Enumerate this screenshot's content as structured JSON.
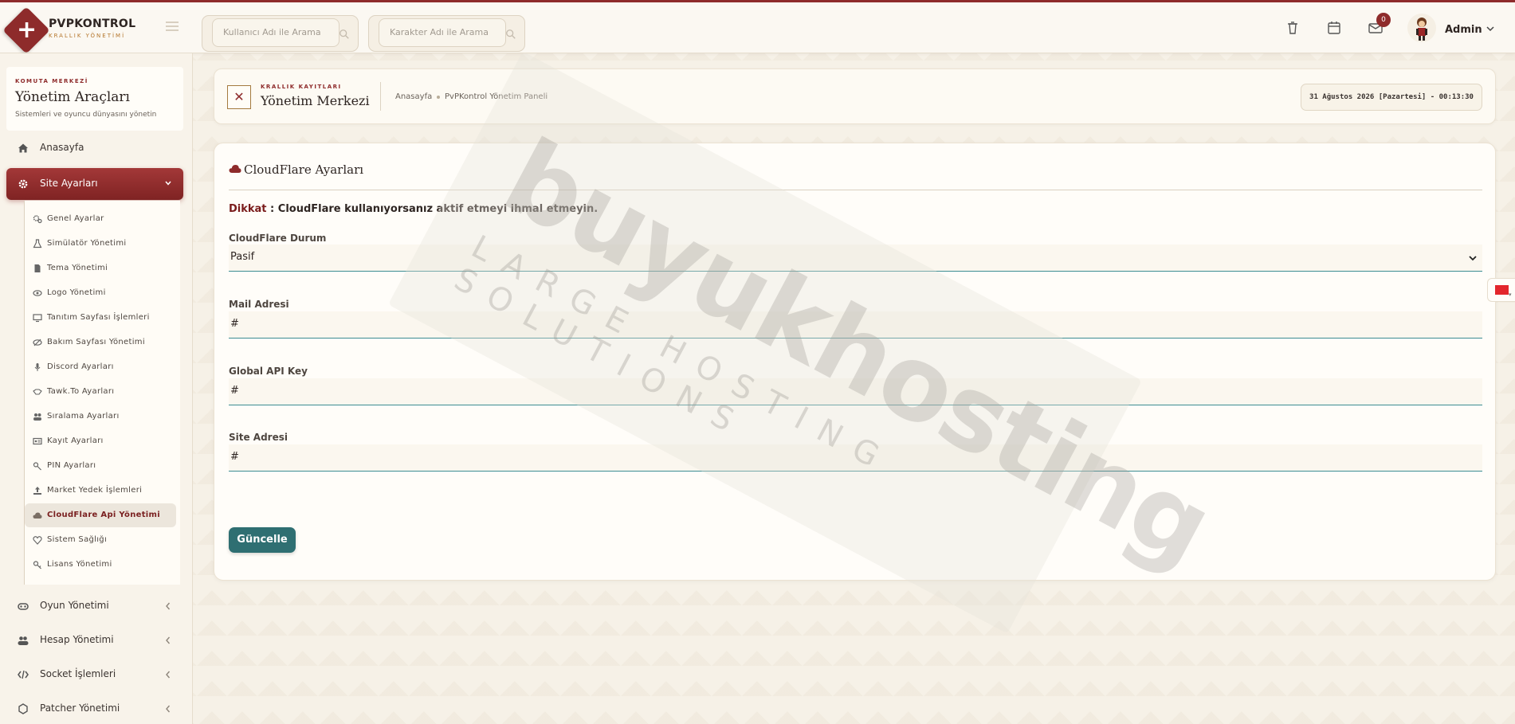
{
  "brand": {
    "title": "PVPKONTROL",
    "subtitle": "KRALLIK YÖNETİMİ"
  },
  "search": {
    "user_placeholder": "Kullanıcı Adı ile Arama",
    "char_placeholder": "Karakter Adı ile Arama"
  },
  "topbar": {
    "notification_count": "0",
    "admin_name": "Admin"
  },
  "sidebar": {
    "command_tag": "KOMUTA MERKEZİ",
    "command_title": "Yönetim Araçları",
    "command_sub": "Sistemleri ve oyuncu dünyasını yönetin",
    "items": [
      {
        "label": "Anasayfa",
        "icon": "home-icon"
      },
      {
        "label": "Site Ayarları",
        "icon": "gear-icon"
      },
      {
        "label": "Oyun Yönetimi",
        "icon": "gamepad-icon"
      },
      {
        "label": "Hesap Yönetimi",
        "icon": "users-icon"
      },
      {
        "label": "Socket İşlemleri",
        "icon": "code-icon"
      },
      {
        "label": "Patcher Yönetimi",
        "icon": "patcher-icon"
      }
    ],
    "submenu": [
      {
        "label": "Genel Ayarlar"
      },
      {
        "label": "Simülatör Yönetimi"
      },
      {
        "label": "Tema Yönetimi"
      },
      {
        "label": "Logo Yönetimi"
      },
      {
        "label": "Tanıtım Sayfası İşlemleri"
      },
      {
        "label": "Bakım Sayfası Yönetimi"
      },
      {
        "label": "Discord Ayarları"
      },
      {
        "label": "Tawk.To Ayarları"
      },
      {
        "label": "Sıralama Ayarları"
      },
      {
        "label": "Kayıt Ayarları"
      },
      {
        "label": "PIN Ayarları"
      },
      {
        "label": "Market Yedek İşlemleri"
      },
      {
        "label": "CloudFlare Api Yönetimi"
      },
      {
        "label": "Sistem Sağlığı"
      },
      {
        "label": "Lisans Yönetimi"
      }
    ]
  },
  "header": {
    "tag": "KRALLIK KAYITLARI",
    "title": "Yönetim Merkezi",
    "breadcrumb_home": "Anasayfa",
    "breadcrumb_current": "PvPKontrol Yönetim Paneli",
    "datetime": "31 Ağustos 2026 [Pazartesi] - 00:13:30"
  },
  "main": {
    "title": "CloudFlare Ayarları",
    "warning_lead": "Dikkat",
    "warning_text": " : CloudFlare kullanıyorsanız aktif etmeyi ihmal etmeyin.",
    "fields": [
      {
        "label": "CloudFlare Durum",
        "value": "Pasif"
      },
      {
        "label": "Mail Adresi",
        "value": "#"
      },
      {
        "label": "Global API Key",
        "value": "#"
      },
      {
        "label": "Site Adresi",
        "value": "#"
      }
    ],
    "submit_label": "Güncelle"
  },
  "watermark": {
    "big": "buyukhosting",
    "small": "LARGE HOSTING SOLUTIONS"
  },
  "colors": {
    "accent": "#8e2b2b",
    "teal": "#2f6f72",
    "input_line": "#3c8d93",
    "background": "#f6f1e7"
  }
}
